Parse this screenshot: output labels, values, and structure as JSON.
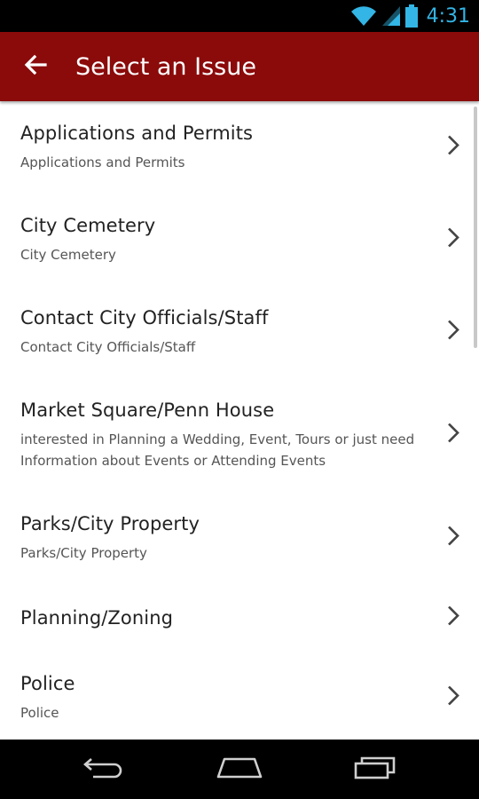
{
  "status": {
    "time": "4:31"
  },
  "header": {
    "title": "Select an Issue"
  },
  "items": [
    {
      "title": "Applications and Permits",
      "subtitle": "Applications and Permits"
    },
    {
      "title": "City Cemetery",
      "subtitle": "City Cemetery"
    },
    {
      "title": "Contact City Officials/Staff",
      "subtitle": "Contact City Officials/Staff"
    },
    {
      "title": "Market Square/Penn House",
      "subtitle": "interested in Planning a Wedding, Event, Tours or just need Information about Events or Attending Events"
    },
    {
      "title": "Parks/City Property",
      "subtitle": "Parks/City Property"
    },
    {
      "title": "Planning/Zoning",
      "subtitle": ""
    },
    {
      "title": "Police",
      "subtitle": "Police"
    }
  ],
  "icons": {
    "back": "arrow-left-icon",
    "chevron": "chevron-right-icon",
    "wifi": "wifi-icon",
    "signal": "signal-icon",
    "battery": "battery-icon",
    "nav_back": "nav-back-icon",
    "nav_home": "nav-home-icon",
    "nav_recents": "nav-recents-icon"
  },
  "colors": {
    "app_bar": "#8b0a0a",
    "status_accent": "#33b5e5",
    "list_background": "#ffffff"
  }
}
